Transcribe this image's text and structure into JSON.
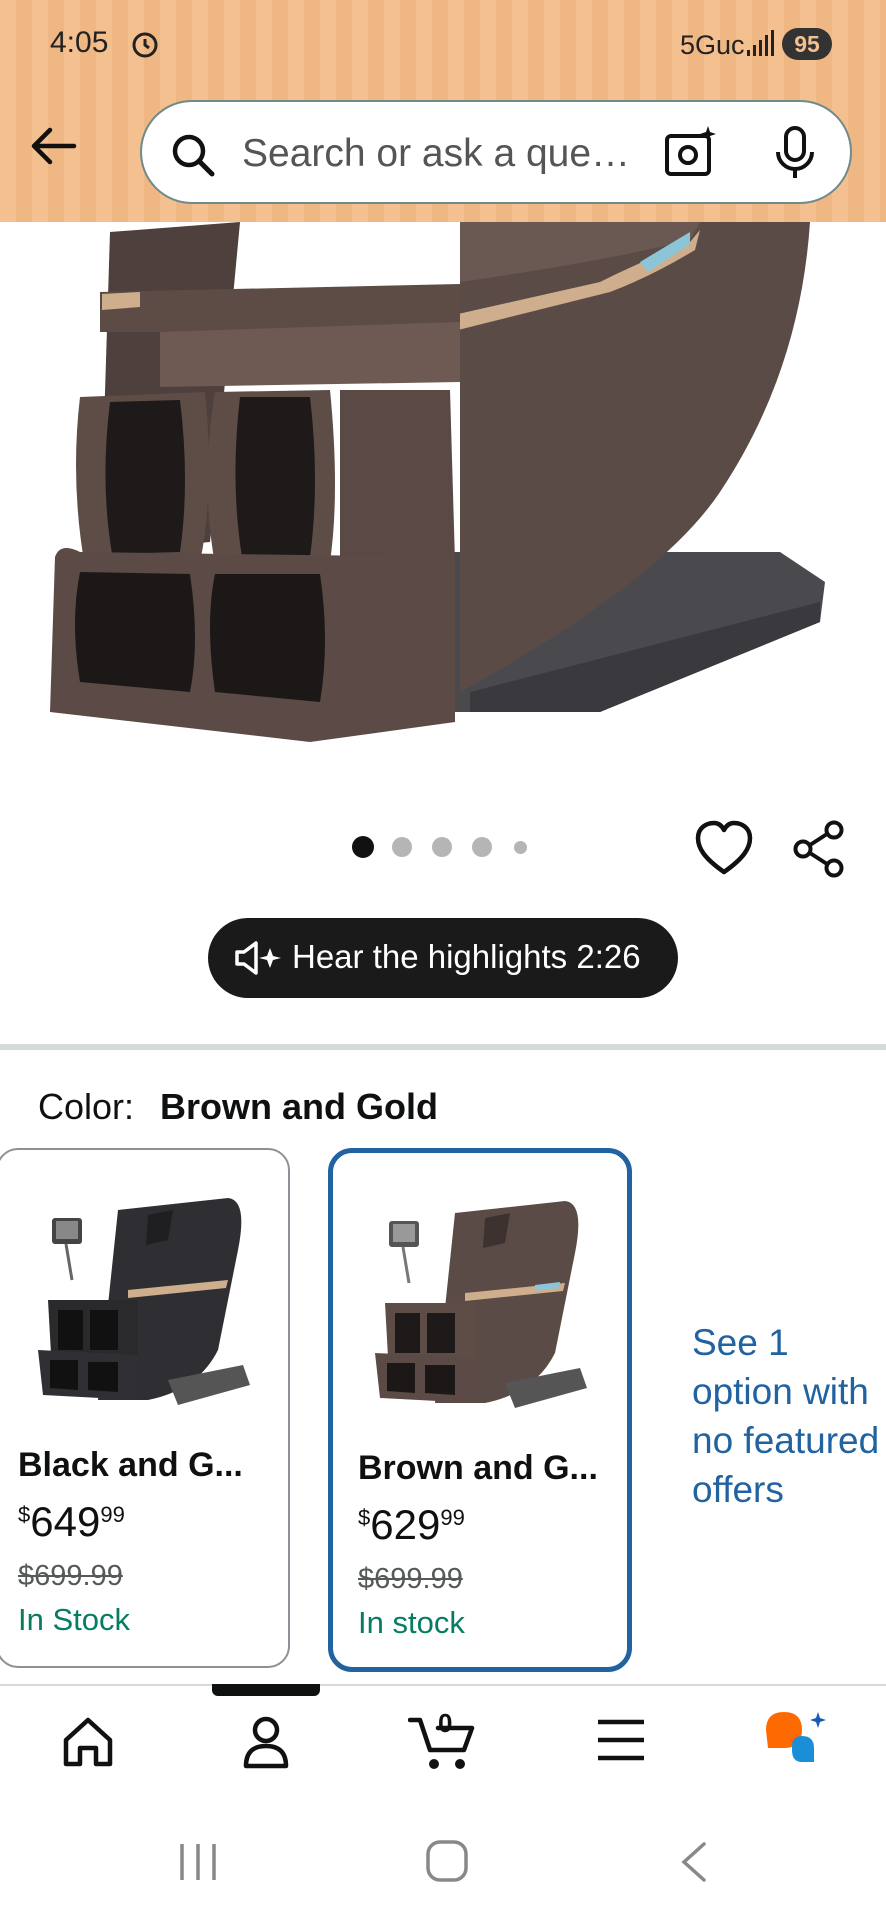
{
  "status_bar": {
    "time": "4:05",
    "network": "5Guc",
    "battery": "95"
  },
  "search": {
    "placeholder": "Search or ask a que…"
  },
  "gallery": {
    "total_images": 5,
    "active_index": 0
  },
  "audio": {
    "label": "Hear the highlights 2:26"
  },
  "color_selector": {
    "label": "Color:",
    "selected": "Brown and Gold",
    "options": [
      {
        "name": "Black and G...",
        "price_dollars": "649",
        "price_cents": "99",
        "currency": "$",
        "list_price": "$699.99",
        "stock": "In Stock"
      },
      {
        "name": "Brown and G...",
        "price_dollars": "629",
        "price_cents": "99",
        "currency": "$",
        "list_price": "$699.99",
        "stock": "In stock"
      }
    ],
    "more_options": "See 1 option with no featured offers"
  },
  "bottom_nav": {
    "cart_count": "0",
    "items": [
      "home-icon",
      "account-icon",
      "cart-icon",
      "menu-icon",
      "rufus-icon"
    ]
  },
  "colors": {
    "header_bg": "#f5c08f",
    "link": "#2162a1",
    "stock_green": "#067d62",
    "selected_border": "#2162a1"
  }
}
